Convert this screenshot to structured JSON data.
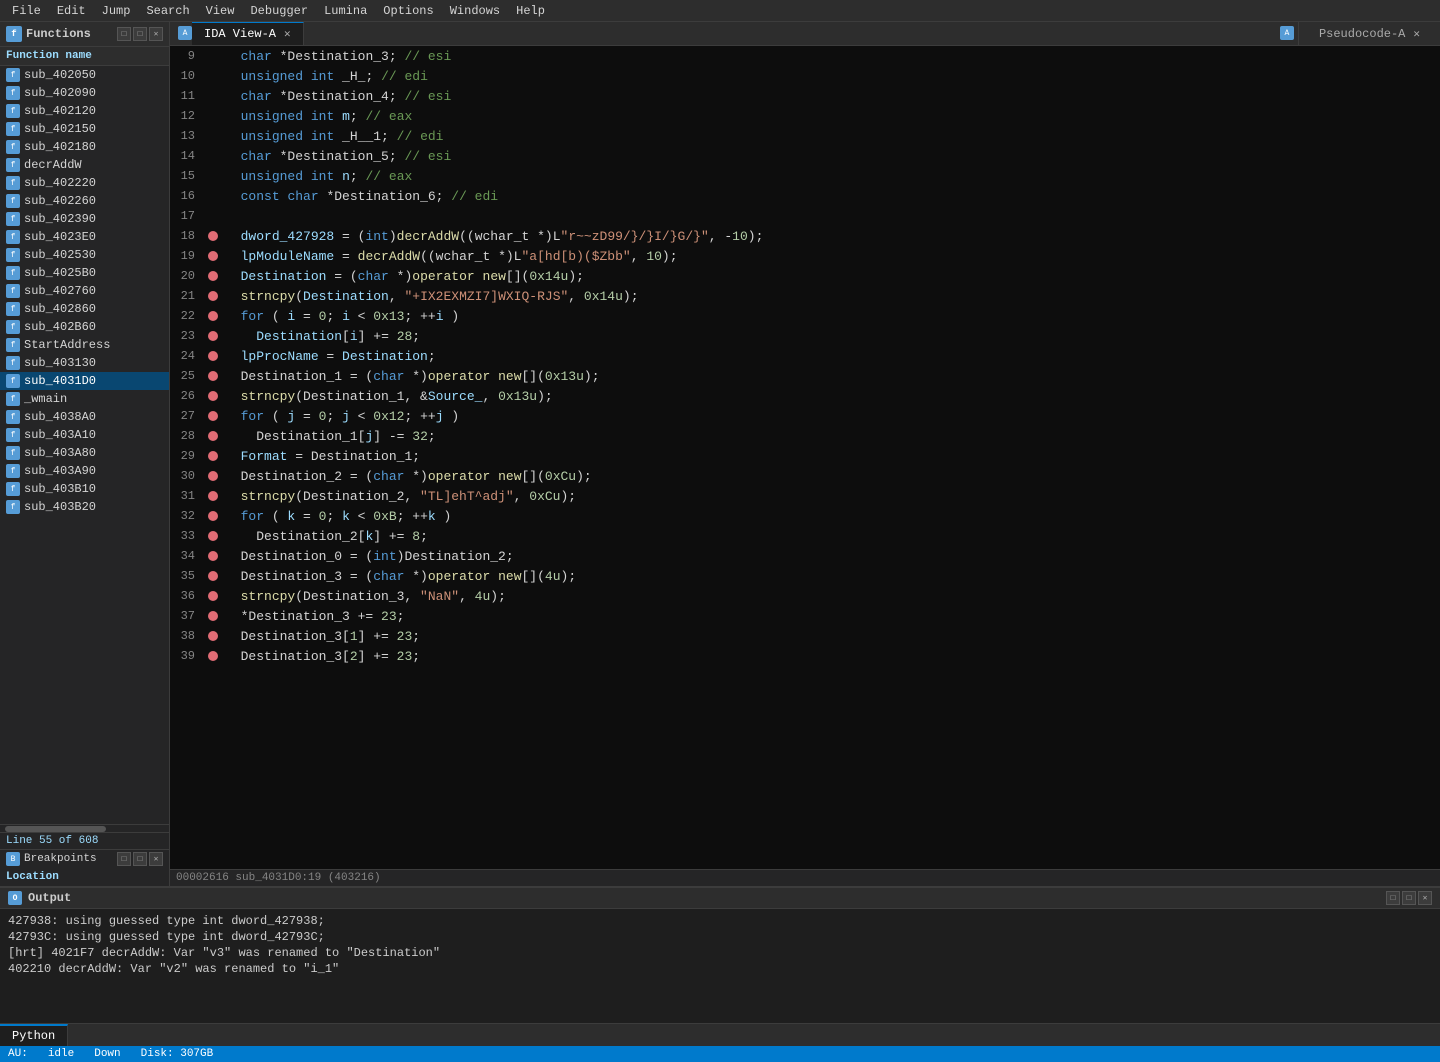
{
  "menubar": {
    "items": [
      "File",
      "Edit",
      "Jump",
      "Search",
      "View",
      "Debugger",
      "Lumina",
      "Options",
      "Windows",
      "Help"
    ]
  },
  "left_panel": {
    "title": "Functions",
    "column_header": "Function name",
    "functions": [
      {
        "name": "sub_402050",
        "selected": false
      },
      {
        "name": "sub_402090",
        "selected": false
      },
      {
        "name": "sub_402120",
        "selected": false
      },
      {
        "name": "sub_402150",
        "selected": false
      },
      {
        "name": "sub_402180",
        "selected": false
      },
      {
        "name": "decrAddW",
        "selected": false
      },
      {
        "name": "sub_402220",
        "selected": false
      },
      {
        "name": "sub_402260",
        "selected": false
      },
      {
        "name": "sub_402390",
        "selected": false
      },
      {
        "name": "sub_4023E0",
        "selected": false
      },
      {
        "name": "sub_402530",
        "selected": false
      },
      {
        "name": "sub_4025B0",
        "selected": false
      },
      {
        "name": "sub_402760",
        "selected": false
      },
      {
        "name": "sub_402860",
        "selected": false
      },
      {
        "name": "sub_402B60",
        "selected": false
      },
      {
        "name": "StartAddress",
        "selected": false
      },
      {
        "name": "sub_403130",
        "selected": false
      },
      {
        "name": "sub_4031D0",
        "selected": true
      },
      {
        "name": "_wmain",
        "selected": false
      },
      {
        "name": "sub_4038A0",
        "selected": false
      },
      {
        "name": "sub_403A10",
        "selected": false
      },
      {
        "name": "sub_403A80",
        "selected": false
      },
      {
        "name": "sub_403A90",
        "selected": false
      },
      {
        "name": "sub_403B10",
        "selected": false
      },
      {
        "name": "sub_403B20",
        "selected": false
      }
    ],
    "status_line": "Line 55 of 608",
    "breakpoints_label": "Breakpoints",
    "location_label": "Location"
  },
  "tabs": {
    "ida_view": "IDA View-A",
    "pseudocode": "Pseudocode-A"
  },
  "code": {
    "lines": [
      {
        "num": 9,
        "bp": false,
        "text": "  char *Destination_3; // esi",
        "type": "decl"
      },
      {
        "num": 10,
        "bp": false,
        "text": "  unsigned int _H_; // edi",
        "type": "decl"
      },
      {
        "num": 11,
        "bp": false,
        "text": "  char *Destination_4; // esi",
        "type": "decl"
      },
      {
        "num": 12,
        "bp": false,
        "text": "  unsigned int m; // eax",
        "type": "decl"
      },
      {
        "num": 13,
        "bp": false,
        "text": "  unsigned int _H__1; // edi",
        "type": "decl"
      },
      {
        "num": 14,
        "bp": false,
        "text": "  char *Destination_5; // esi",
        "type": "decl"
      },
      {
        "num": 15,
        "bp": false,
        "text": "  unsigned int n; // eax",
        "type": "decl"
      },
      {
        "num": 16,
        "bp": false,
        "text": "  const char *Destination_6; // edi",
        "type": "decl"
      },
      {
        "num": 17,
        "bp": false,
        "text": "",
        "type": "empty"
      },
      {
        "num": 18,
        "bp": true,
        "text": "  dword_427928 = (int)decrAddW((wchar_t *)L\"r~~zD99/}/}I/}G/}\", -10);",
        "type": "stmt"
      },
      {
        "num": 19,
        "bp": true,
        "text": "  lpModuleName = decrAddW((wchar_t *)L\"a[hd[b)($Zbb\", 10);",
        "type": "stmt"
      },
      {
        "num": 20,
        "bp": true,
        "text": "  Destination = (char *)operator new[](0x14u);",
        "type": "stmt"
      },
      {
        "num": 21,
        "bp": true,
        "text": "  strncpy(Destination, \"+IX2EXMZI7]WXIQ-RJS\", 0x14u);",
        "type": "stmt"
      },
      {
        "num": 22,
        "bp": true,
        "text": "  for ( i = 0; i < 0x13; ++i )",
        "type": "stmt"
      },
      {
        "num": 23,
        "bp": true,
        "text": "    Destination[i] += 28;",
        "type": "stmt"
      },
      {
        "num": 24,
        "bp": true,
        "text": "  lpProcName = Destination;",
        "type": "stmt"
      },
      {
        "num": 25,
        "bp": true,
        "text": "  Destination_1 = (char *)operator new[](0x13u);",
        "type": "stmt"
      },
      {
        "num": 26,
        "bp": true,
        "text": "  strncpy(Destination_1, &Source_, 0x13u);",
        "type": "stmt"
      },
      {
        "num": 27,
        "bp": true,
        "text": "  for ( j = 0; j < 0x12; ++j )",
        "type": "stmt"
      },
      {
        "num": 28,
        "bp": true,
        "text": "    Destination_1[j] -= 32;",
        "type": "stmt"
      },
      {
        "num": 29,
        "bp": true,
        "text": "  Format = Destination_1;",
        "type": "stmt"
      },
      {
        "num": 30,
        "bp": true,
        "text": "  Destination_2 = (char *)operator new[](0xCu);",
        "type": "stmt"
      },
      {
        "num": 31,
        "bp": true,
        "text": "  strncpy(Destination_2, \"TL]ehT^adj\", 0xCu);",
        "type": "stmt"
      },
      {
        "num": 32,
        "bp": true,
        "text": "  for ( k = 0; k < 0xB; ++k )",
        "type": "stmt"
      },
      {
        "num": 33,
        "bp": true,
        "text": "    Destination_2[k] += 8;",
        "type": "stmt"
      },
      {
        "num": 34,
        "bp": true,
        "text": "  Destination_0 = (int)Destination_2;",
        "type": "stmt"
      },
      {
        "num": 35,
        "bp": true,
        "text": "  Destination_3 = (char *)operator new[](4u);",
        "type": "stmt"
      },
      {
        "num": 36,
        "bp": true,
        "text": "  strncpy(Destination_3, \"NaN\", 4u);",
        "type": "stmt"
      },
      {
        "num": 37,
        "bp": true,
        "text": "  *Destination_3 += 23;",
        "type": "stmt"
      },
      {
        "num": 38,
        "bp": true,
        "text": "  Destination_3[1] += 23;",
        "type": "stmt"
      },
      {
        "num": 39,
        "bp": true,
        "text": "  Destination_3[2] += 23;",
        "type": "stmt"
      }
    ],
    "address_bar": "00002616 sub_4031D0:19 (403216)"
  },
  "bottom": {
    "title": "Output",
    "lines": [
      "427938: using guessed type int dword_427938;",
      "42793C: using guessed type int dword_42793C;",
      "[hrt] 4021F7 decrAddW: Var \"v3\" was renamed to \"Destination\"",
      "402210 decrAddW: Var \"v2\" was renamed to \"i_1\""
    ],
    "tabs": [
      "Python"
    ]
  },
  "footer": {
    "state": "AU:",
    "idle": "idle",
    "down": "Down",
    "disk": "Disk: 307GB"
  }
}
